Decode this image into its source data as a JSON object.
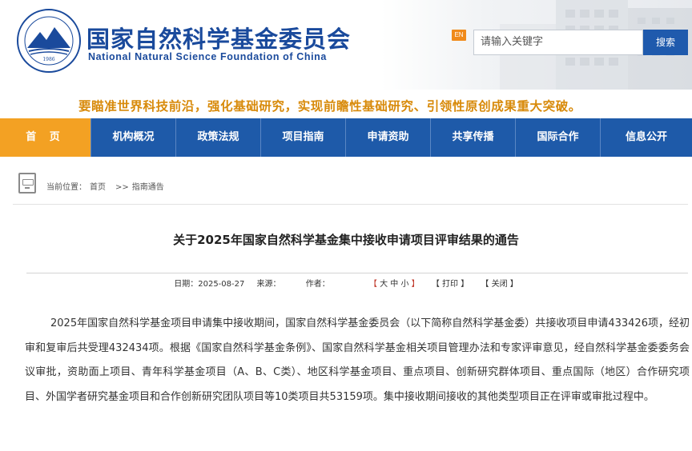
{
  "header": {
    "org_name_cn": "国家自然科学基金委员会",
    "org_name_en": "National Natural Science Foundation of China",
    "logo_year": "1986",
    "en_label": "EN",
    "search_placeholder": "请输入关键字",
    "search_button": "搜索"
  },
  "slogan": "要瞄准世界科技前沿，强化基础研究，实现前瞻性基础研究、引领性原创成果重大突破。",
  "nav": {
    "items": [
      {
        "label": "首 页"
      },
      {
        "label": "机构概况"
      },
      {
        "label": "政策法规"
      },
      {
        "label": "项目指南"
      },
      {
        "label": "申请资助"
      },
      {
        "label": "共享传播"
      },
      {
        "label": "国际合作"
      },
      {
        "label": "信息公开"
      }
    ]
  },
  "breadcrumb": {
    "prefix": "当前位置：",
    "home": "首页",
    "separator": ">>",
    "current": "指南通告"
  },
  "article": {
    "title": "关于2025年国家自然科学基金集中接收申请项目评审结果的通告",
    "date_label": "日期：2025-08-27",
    "source_label": "来源：",
    "author_label": "作者：",
    "font_size": {
      "open": "【",
      "large": "大",
      "medium": "中",
      "small": "小",
      "close": "】"
    },
    "print": "【 打印 】",
    "close": "【 关闭 】",
    "body": "2025年国家自然科学基金项目申请集中接收期间，国家自然科学基金委员会（以下简称自然科学基金委）共接收项目申请433426项，经初审和复审后共受理432434项。根据《国家自然科学基金条例》、国家自然科学基金相关项目管理办法和专家评审意见，经自然科学基金委委务会议审批，资助面上项目、青年科学基金项目（A、B、C类）、地区科学基金项目、重点项目、创新研究群体项目、重点国际（地区）合作研究项目、外国学者研究基金项目和合作创新研究团队项目等10类项目共53159项。集中接收期间接收的其他类型项目正在评审或审批过程中。"
  },
  "colors": {
    "brand_blue": "#1e5aa9",
    "nav_active": "#f3a123",
    "slogan": "#d88a0a"
  }
}
